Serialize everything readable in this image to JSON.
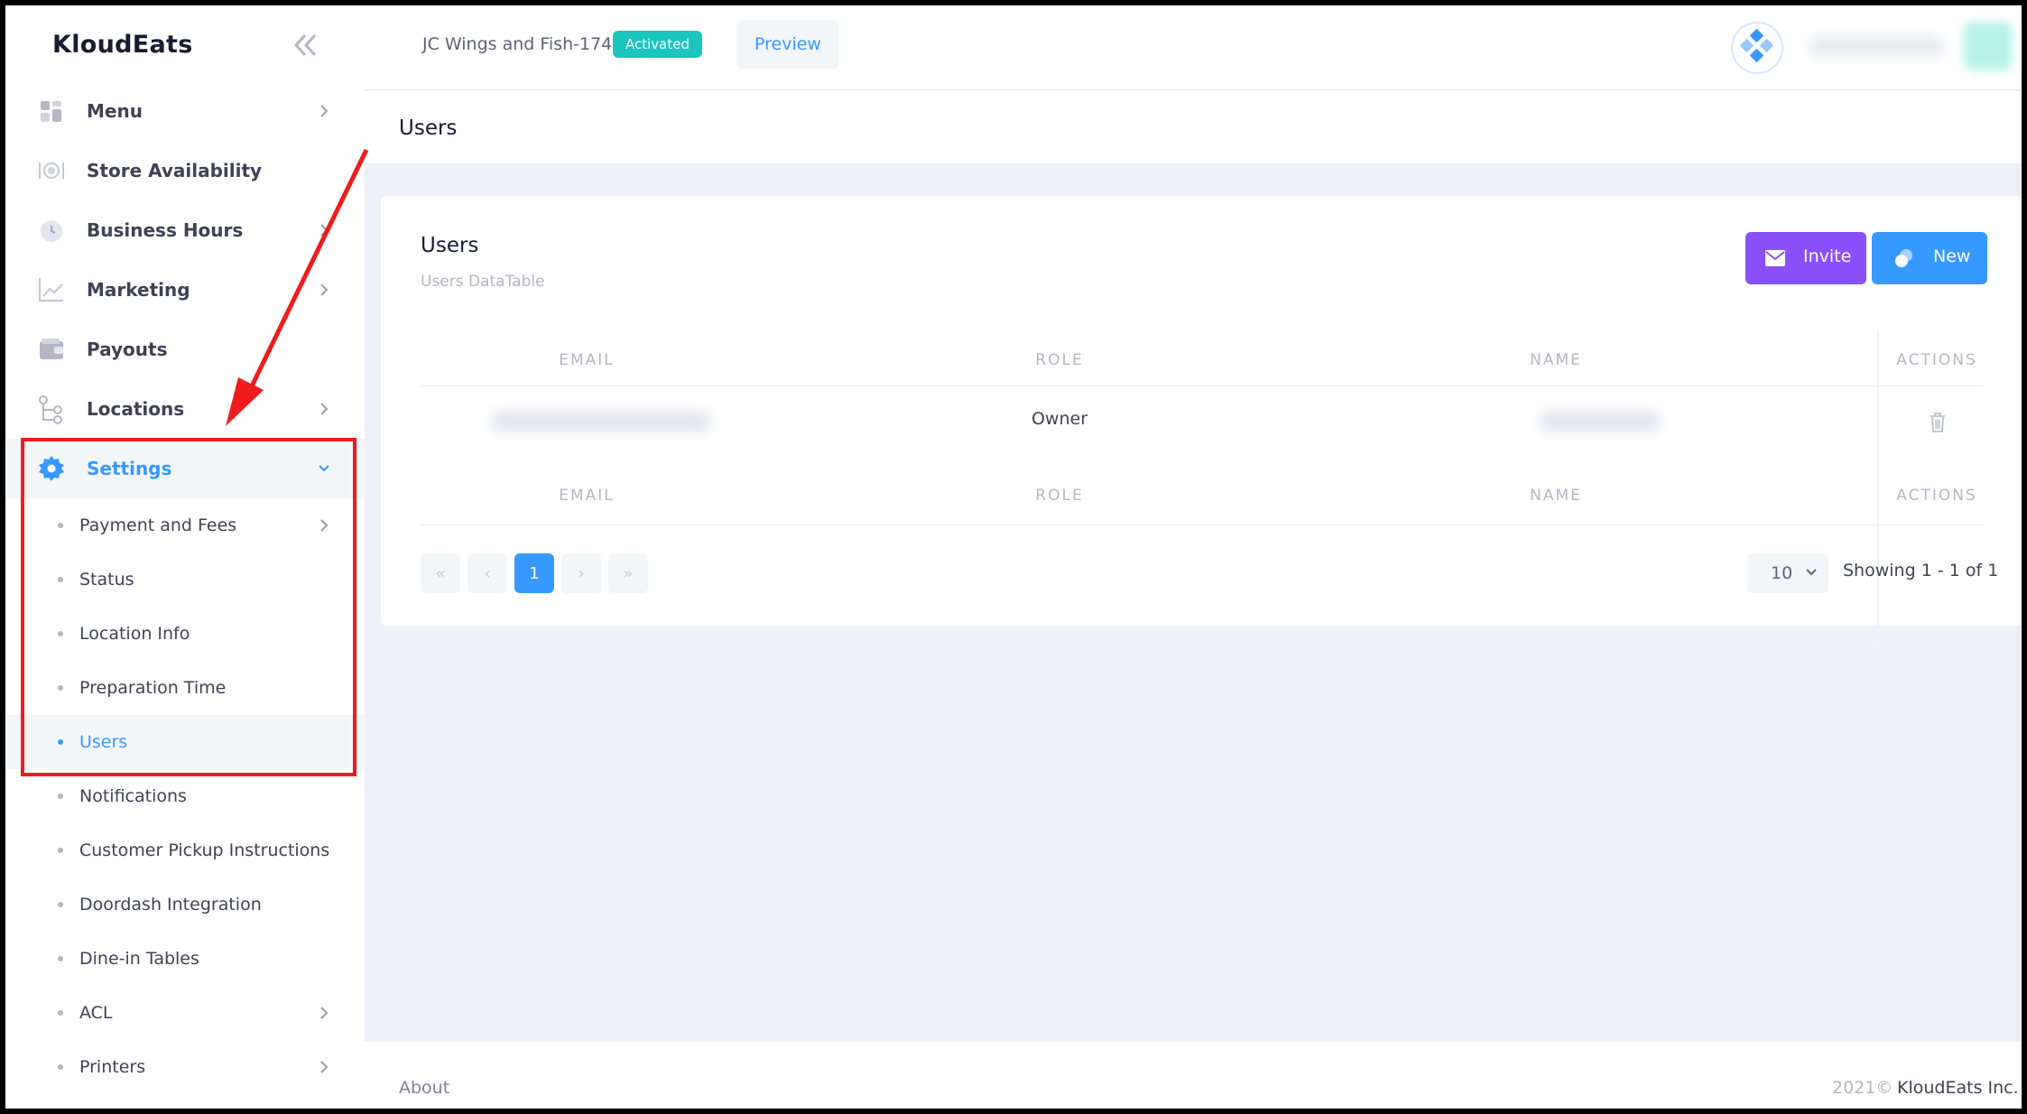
{
  "app": {
    "brand": "KloudEats"
  },
  "header": {
    "store_name": "JC Wings and Fish-174",
    "status_badge": "Activated",
    "preview_label": "Preview"
  },
  "sidebar": {
    "items": [
      {
        "label": "Menu",
        "icon": "menu-grid-icon"
      },
      {
        "label": "Store Availability",
        "icon": "dining-icon"
      },
      {
        "label": "Business Hours",
        "icon": "clock-icon"
      },
      {
        "label": "Marketing",
        "icon": "chart-icon"
      },
      {
        "label": "Payouts",
        "icon": "wallet-icon"
      },
      {
        "label": "Locations",
        "icon": "locations-icon"
      },
      {
        "label": "Settings",
        "icon": "gear-icon"
      }
    ],
    "settings_children": [
      {
        "label": "Payment and Fees"
      },
      {
        "label": "Status"
      },
      {
        "label": "Location Info"
      },
      {
        "label": "Preparation Time"
      },
      {
        "label": "Users"
      },
      {
        "label": "Notifications"
      },
      {
        "label": "Customer Pickup Instructions"
      },
      {
        "label": "Doordash Integration"
      },
      {
        "label": "Dine-in Tables"
      },
      {
        "label": "ACL"
      },
      {
        "label": "Printers"
      }
    ]
  },
  "subheader": {
    "title": "Users"
  },
  "card": {
    "title": "Users",
    "subtitle": "Users DataTable",
    "invite_label": "Invite",
    "new_label": "New",
    "columns": [
      "EMAIL",
      "ROLE",
      "NAME",
      "ACTIONS"
    ],
    "rows": [
      {
        "email": "",
        "role": "Owner",
        "name": ""
      }
    ],
    "pagination": {
      "first": "«",
      "prev": "‹",
      "current": "1",
      "next": "›",
      "last": "»",
      "page_size": "10",
      "showing": "Showing 1 - 1 of 1"
    }
  },
  "footer": {
    "about": "About",
    "copyright": "2021©",
    "company": "KloudEats Inc."
  },
  "colors": {
    "primary": "#3699ff",
    "invite": "#8950fc",
    "activated": "#1bc5bd",
    "annotation": "#ee1c1c"
  }
}
